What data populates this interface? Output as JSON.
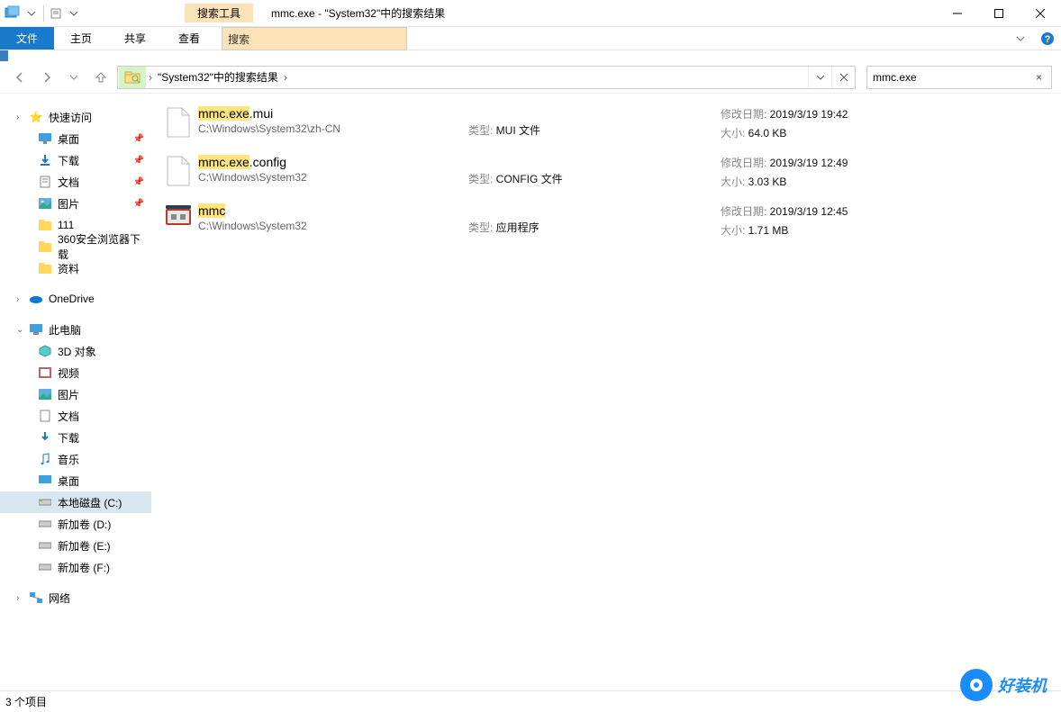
{
  "title": {
    "context_tab": "搜索工具",
    "window_title": "mmc.exe - \"System32\"中的搜索结果"
  },
  "ribbon": {
    "file": "文件",
    "home": "主页",
    "share": "共享",
    "view": "查看",
    "search": "搜索"
  },
  "address": {
    "location": "\"System32\"中的搜索结果"
  },
  "search": {
    "query": "mmc.exe"
  },
  "sidebar": {
    "quick_access": "快速访问",
    "desktop": "桌面",
    "downloads": "下载",
    "documents": "文档",
    "pictures": "图片",
    "folder_111": "111",
    "folder_360": "360安全浏览器下载",
    "folder_ziliao": "资料",
    "onedrive": "OneDrive",
    "this_pc": "此电脑",
    "objects_3d": "3D 对象",
    "videos": "视频",
    "pictures2": "图片",
    "documents2": "文档",
    "downloads2": "下载",
    "music": "音乐",
    "desktop2": "桌面",
    "local_c": "本地磁盘 (C:)",
    "vol_d": "新加卷 (D:)",
    "vol_e": "新加卷 (E:)",
    "vol_f": "新加卷 (F:)",
    "network": "网络"
  },
  "results": [
    {
      "name_hl": "mmc.exe",
      "name_rest": ".mui",
      "path": "C:\\Windows\\System32\\zh-CN",
      "type_label": "类型:",
      "type": "MUI 文件",
      "date_label": "修改日期:",
      "date": "2019/3/19 19:42",
      "size_label": "大小:",
      "size": "64.0 KB",
      "icon": "file"
    },
    {
      "name_hl": "mmc.exe",
      "name_rest": ".config",
      "path": "C:\\Windows\\System32",
      "type_label": "类型:",
      "type": "CONFIG 文件",
      "date_label": "修改日期:",
      "date": "2019/3/19 12:49",
      "size_label": "大小:",
      "size": "3.03 KB",
      "icon": "file"
    },
    {
      "name_hl": "mmc",
      "name_rest": "",
      "path": "C:\\Windows\\System32",
      "type_label": "类型:",
      "type": "应用程序",
      "date_label": "修改日期:",
      "date": "2019/3/19 12:45",
      "size_label": "大小:",
      "size": "1.71 MB",
      "icon": "mmc"
    }
  ],
  "status": {
    "count": "3 个项目"
  },
  "watermark": "好装机"
}
